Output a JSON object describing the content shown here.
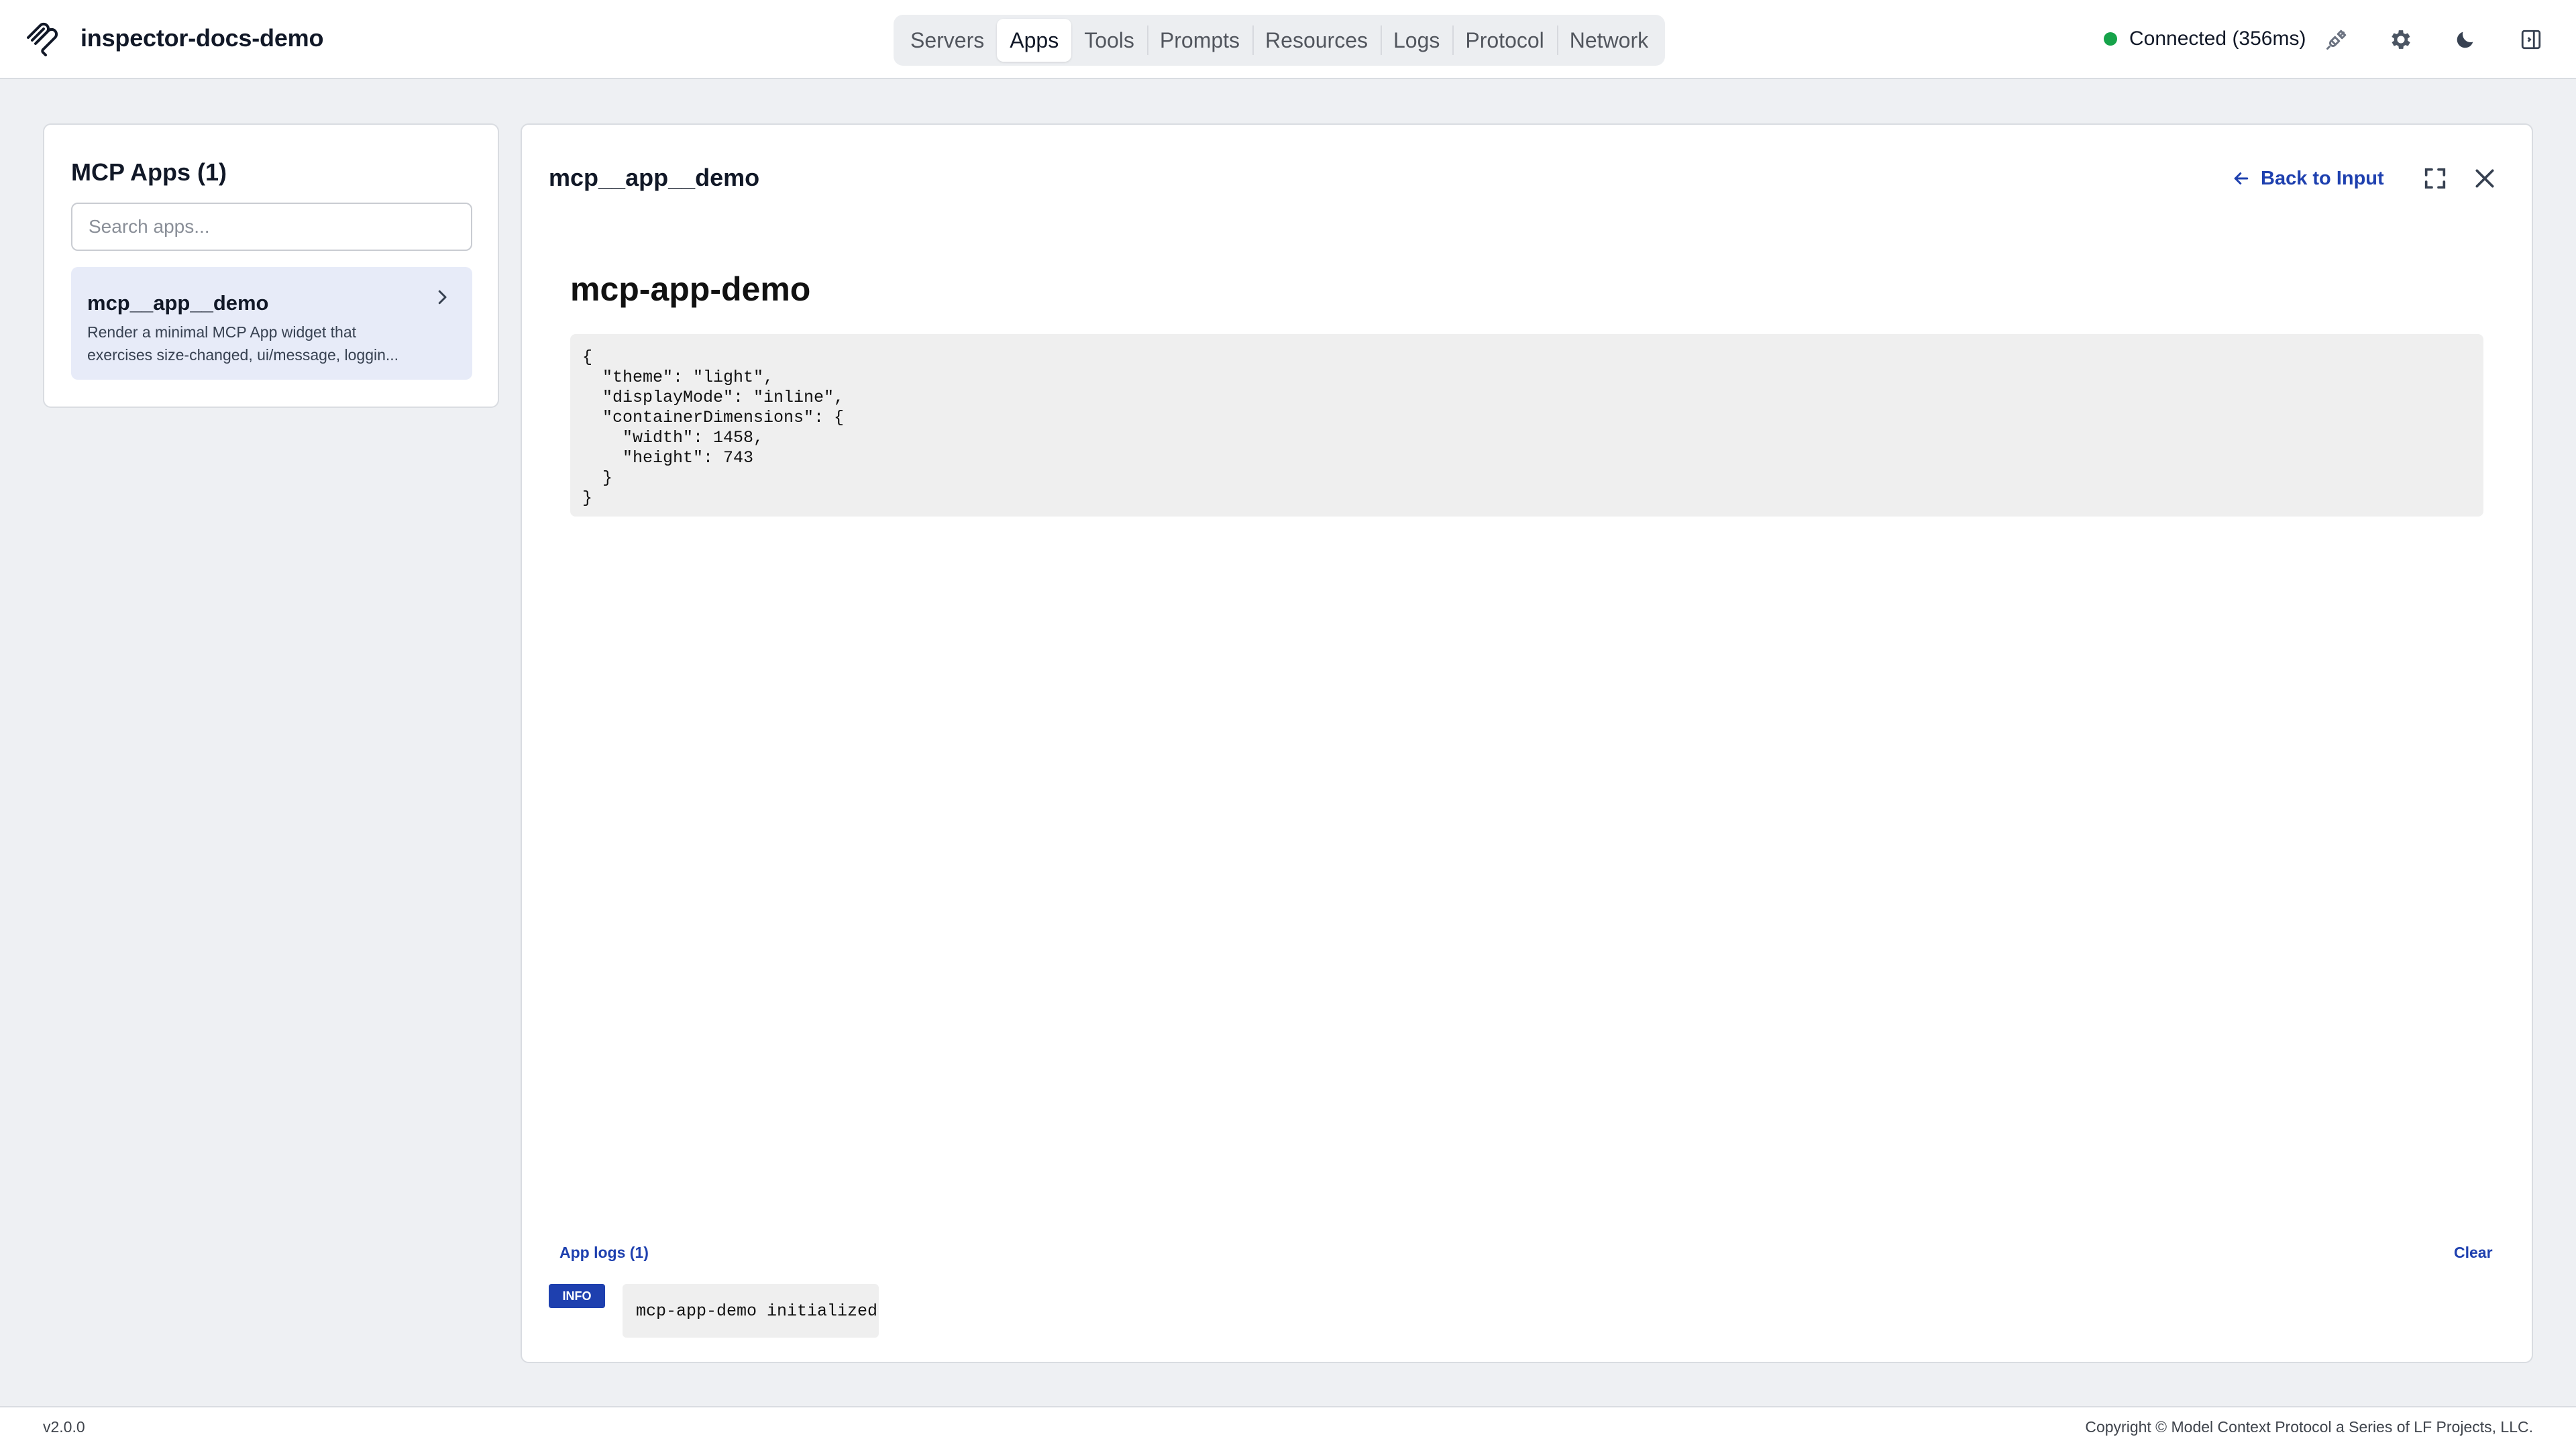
{
  "header": {
    "title": "inspector-docs-demo",
    "nav_tabs": [
      {
        "label": "Servers"
      },
      {
        "label": "Apps",
        "active": true
      },
      {
        "label": "Tools"
      },
      {
        "label": "Prompts"
      },
      {
        "label": "Resources"
      },
      {
        "label": "Logs"
      },
      {
        "label": "Protocol"
      },
      {
        "label": "Network"
      }
    ],
    "status": {
      "text": "Connected (356ms)",
      "color": "#16a34a"
    },
    "icons": [
      "disconnect-plug-icon",
      "settings-gear-icon",
      "dark-mode-moon-icon",
      "sidebar-toggle-icon"
    ]
  },
  "sidebar": {
    "title": "MCP Apps (1)",
    "search_placeholder": "Search apps...",
    "apps": [
      {
        "name": "mcp__app__demo",
        "desc_line1": "Render a minimal MCP App widget that",
        "desc_line2": "exercises size-changed, ui/message, loggin..."
      }
    ]
  },
  "main": {
    "title": "mcp__app__demo",
    "back_label": "Back to Input",
    "widget": {
      "heading": "mcp-app-demo",
      "code": "{\n  \"theme\": \"light\",\n  \"displayMode\": \"inline\",\n  \"containerDimensions\": {\n    \"width\": 1458,\n    \"height\": 743\n  }\n}"
    },
    "logs": {
      "label": "App logs (1)",
      "clear_label": "Clear",
      "entries": [
        {
          "level": "INFO",
          "message": "mcp-app-demo initialized"
        }
      ]
    }
  },
  "footer": {
    "version": "v2.0.0",
    "copyright": "Copyright © Model Context Protocol a Series of LF Projects, LLC."
  },
  "colors": {
    "accent": "#1e40af",
    "selected_bg": "#e7ebf8",
    "status_green": "#16a34a",
    "page_bg": "#eef0f3"
  }
}
